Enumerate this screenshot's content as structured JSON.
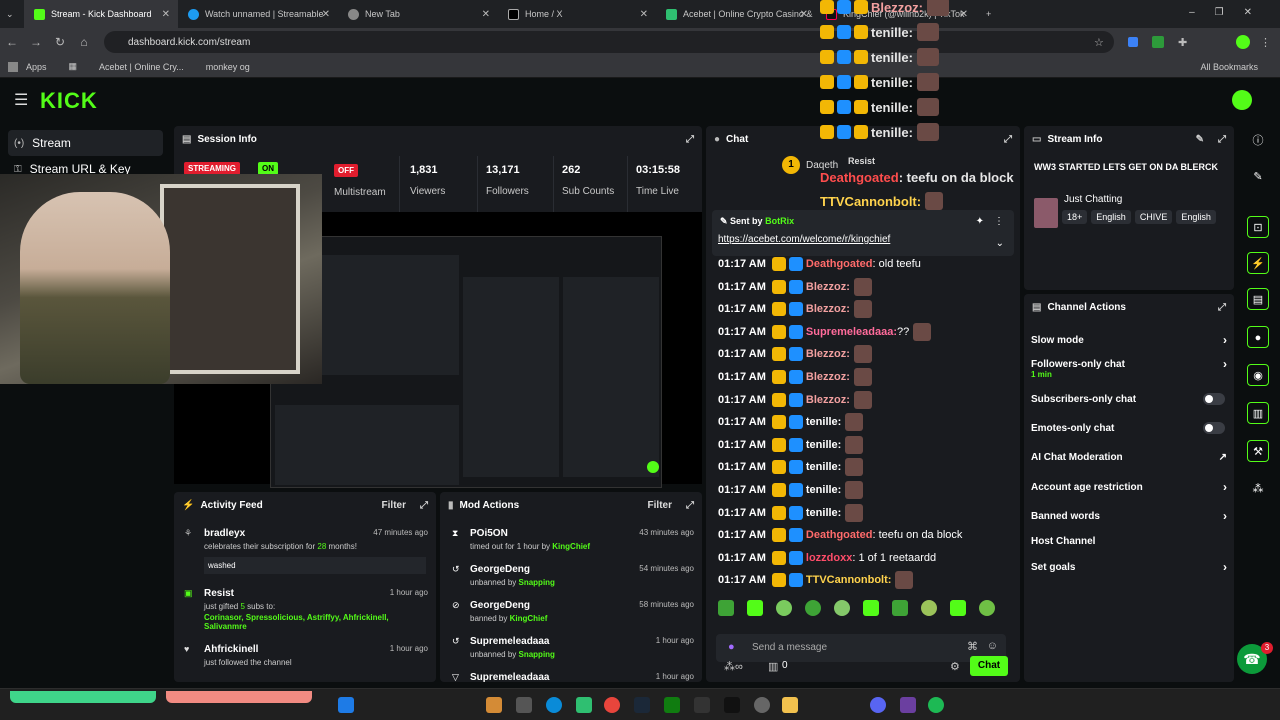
{
  "tabs": [
    {
      "title": "Stream - Kick Dashboard",
      "active": true
    },
    {
      "title": "Watch unnamed | Streamable"
    },
    {
      "title": "New Tab"
    },
    {
      "title": "Home / X"
    },
    {
      "title": "Acebet | Online Crypto Casino &"
    },
    {
      "title": "KingChief (@willnb2k) | TikTok"
    }
  ],
  "address": {
    "url": "dashboard.kick.com/stream"
  },
  "bookmarks": {
    "apps": "Apps",
    "b1": "Acebet | Online Cry...",
    "b2": "monkey og",
    "all": "All Bookmarks"
  },
  "sidebar": {
    "items": [
      {
        "label": "Stream"
      },
      {
        "label": "Stream URL & Key"
      }
    ]
  },
  "session": {
    "title": "Session Info",
    "streaming": "STREAMING",
    "on": "ON",
    "off": "OFF",
    "multistream": "Multistream",
    "viewers": {
      "value": "1,831",
      "label": "Viewers"
    },
    "followers": {
      "value": "13,171",
      "label": "Followers"
    },
    "subs": {
      "value": "262",
      "label": "Sub Counts"
    },
    "time": {
      "value": "03:15:58",
      "label": "Time Live"
    }
  },
  "activity": {
    "title": "Activity Feed",
    "filter": "Filter",
    "items": [
      {
        "name": "bradleyx",
        "sub_pre": "celebrates their subscription for ",
        "sub_num": "28",
        "sub_post": " months!",
        "msg": "washed",
        "time": "47 minutes ago"
      },
      {
        "name": "Resist",
        "sub_pre": "just gifted ",
        "sub_num": "5",
        "sub_post": " subs to:",
        "list": "Corinasor, Spressolicious, Astriffyy, Ahfrickinell, Salivanmre",
        "time": "1 hour ago"
      },
      {
        "name": "Ahfrickinell",
        "sub": "just followed the channel",
        "time": "1 hour ago"
      }
    ]
  },
  "mod": {
    "title": "Mod Actions",
    "filter": "Filter",
    "items": [
      {
        "name": "POi5ON",
        "action": "timed out for 1 hour by ",
        "by": "KingChief",
        "time": "43 minutes ago"
      },
      {
        "name": "GeorgeDeng",
        "action": "unbanned by ",
        "by": "Snapping",
        "time": "54 minutes ago"
      },
      {
        "name": "GeorgeDeng",
        "action": "banned by ",
        "by": "KingChief",
        "time": "58 minutes ago"
      },
      {
        "name": "Supremeleadaaa",
        "action": "unbanned by ",
        "by": "Snapping",
        "time": "1 hour ago"
      },
      {
        "name": "Supremeleadaaa",
        "action": "",
        "by": "",
        "time": "1 hour ago"
      }
    ]
  },
  "chat": {
    "title": "Chat",
    "pinned": {
      "sent_by": "Sent by",
      "bot": "BotRix",
      "link": "https://acebet.com/welcome/r/kingchief"
    },
    "top_user": "Daqeth",
    "rows": [
      {
        "time": "01:17 AM",
        "user": "Deathgoated",
        "color": "#ff6b6b",
        "msg": ": old teefu"
      },
      {
        "time": "01:17 AM",
        "user": "Blezzoz:",
        "color": "#f2a0a0",
        "msg": ""
      },
      {
        "time": "01:17 AM",
        "user": "Blezzoz:",
        "color": "#f2a0a0",
        "msg": ""
      },
      {
        "time": "01:17 AM",
        "user": "Supremeleadaaa:",
        "color": "#ff6b9b",
        "msg": " ??"
      },
      {
        "time": "01:17 AM",
        "user": "Blezzoz:",
        "color": "#f2a0a0",
        "msg": ""
      },
      {
        "time": "01:17 AM",
        "user": "Blezzoz:",
        "color": "#f2a0a0",
        "msg": ""
      },
      {
        "time": "01:17 AM",
        "user": "Blezzoz:",
        "color": "#f2a0a0",
        "msg": ""
      },
      {
        "time": "01:17 AM",
        "user": "tenille:",
        "color": "#ffffff",
        "msg": ""
      },
      {
        "time": "01:17 AM",
        "user": "tenille:",
        "color": "#ffffff",
        "msg": ""
      },
      {
        "time": "01:17 AM",
        "user": "tenille:",
        "color": "#ffffff",
        "msg": ""
      },
      {
        "time": "01:17 AM",
        "user": "tenille:",
        "color": "#ffffff",
        "msg": ""
      },
      {
        "time": "01:17 AM",
        "user": "tenille:",
        "color": "#ffffff",
        "msg": ""
      },
      {
        "time": "01:17 AM",
        "user": "Deathgoated",
        "color": "#ff6b6b",
        "msg": ": teefu on da block"
      },
      {
        "time": "01:17 AM",
        "user": "lozzdoxx",
        "color": "#ff4d6a",
        "msg": ": 1 of 1 reetaardd"
      },
      {
        "time": "01:17 AM",
        "user": "TTVCannonbolt:",
        "color": "#ffd34d",
        "msg": ""
      }
    ],
    "input_placeholder": "Send a message",
    "points": "0",
    "chat_button": "Chat"
  },
  "overlay": {
    "rows": [
      "Blezzoz:",
      "tenille:",
      "tenille:",
      "tenille:",
      "tenille:",
      "tenille:"
    ],
    "resist": "Resist",
    "death_user": "Deathgoated",
    "death_msg": ": teefu on da block",
    "cannon": "TTVCannonbolt:"
  },
  "stream_info": {
    "title": "Stream Info",
    "stream_title": "WW3 STARTED LETS GET ON DA BLERCK",
    "category": "Just Chatting",
    "tags": [
      "18+",
      "English",
      "CHIVE",
      "English"
    ]
  },
  "channel_actions": {
    "title": "Channel Actions",
    "items": [
      {
        "label": "Slow mode",
        "kind": "chev"
      },
      {
        "label": "Followers-only chat",
        "sub": "1 min",
        "kind": "chev"
      },
      {
        "label": "Subscribers-only chat",
        "kind": "toggle"
      },
      {
        "label": "Emotes-only chat",
        "kind": "toggle"
      },
      {
        "label": "AI Chat Moderation",
        "kind": "ext"
      },
      {
        "label": "Account age restriction",
        "kind": "chev"
      },
      {
        "label": "Banned words",
        "kind": "chev"
      },
      {
        "label": "Host Channel",
        "kind": "none"
      },
      {
        "label": "Set goals",
        "kind": "chev"
      }
    ]
  },
  "support_badge": "3",
  "colors": {
    "kick_green": "#53fc18",
    "panel": "#191b1f",
    "bg": "#0b0e0f",
    "live_red": "#e11d2e"
  }
}
